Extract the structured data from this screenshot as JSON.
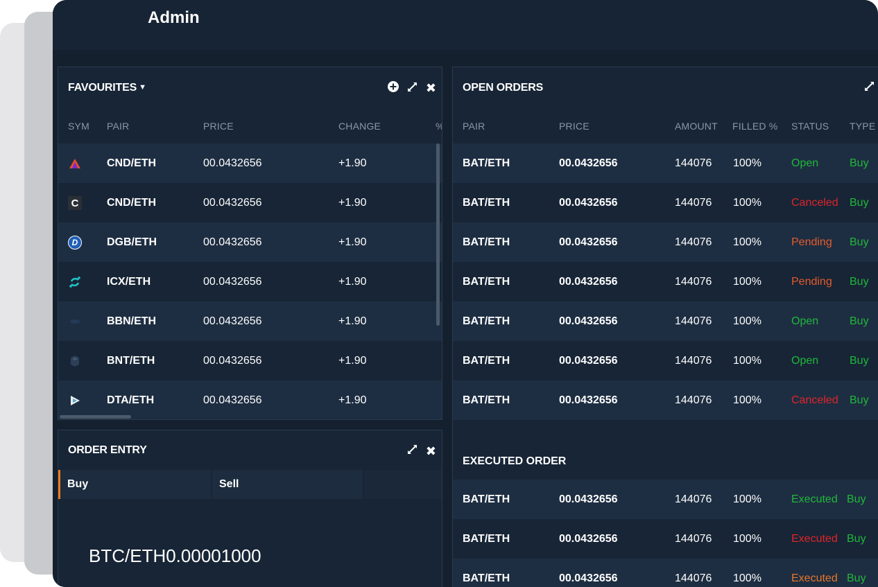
{
  "app": {
    "title": "Admin"
  },
  "favourites": {
    "title": "FAVOURITES",
    "columns": [
      "SYM",
      "PAIR",
      "PRICE",
      "CHANGE",
      "%"
    ],
    "rows": [
      {
        "icon": "triangle-logo-icon",
        "pair": "CND/ETH",
        "price": "00.0432656",
        "change": "+1.90"
      },
      {
        "icon": "c-logo-icon",
        "pair": "CND/ETH",
        "price": "00.0432656",
        "change": "+1.90"
      },
      {
        "icon": "digibyte-logo-icon",
        "pair": "DGB/ETH",
        "price": "00.0432656",
        "change": "+1.90"
      },
      {
        "icon": "icon-logo-icon",
        "pair": "ICX/ETH",
        "price": "00.0432656",
        "change": "+1.90"
      },
      {
        "icon": "bbn-logo-icon",
        "pair": "BBN/ETH",
        "price": "00.0432656",
        "change": "+1.90"
      },
      {
        "icon": "bancor-logo-icon",
        "pair": "BNT/ETH",
        "price": "00.0432656",
        "change": "+1.90"
      },
      {
        "icon": "data-logo-icon",
        "pair": "DTA/ETH",
        "price": "00.0432656",
        "change": "+1.90"
      }
    ]
  },
  "order_entry": {
    "title": "ORDER ENTRY",
    "tabs": [
      "Buy",
      "Sell"
    ],
    "pair_price": "BTC/ETH0.00001000"
  },
  "open_orders": {
    "title": "OPEN ORDERS",
    "columns": [
      "PAIR",
      "PRICE",
      "AMOUNT",
      "FILLED %",
      "STATUS",
      "TYPE"
    ],
    "rows": [
      {
        "pair": "BAT/ETH",
        "price": "00.0432656",
        "amount": "144076",
        "filled": "100%",
        "status": "Open",
        "type": "Buy"
      },
      {
        "pair": "BAT/ETH",
        "price": "00.0432656",
        "amount": "144076",
        "filled": "100%",
        "status": "Canceled",
        "type": "Buy"
      },
      {
        "pair": "BAT/ETH",
        "price": "00.0432656",
        "amount": "144076",
        "filled": "100%",
        "status": "Pending",
        "type": "Buy"
      },
      {
        "pair": "BAT/ETH",
        "price": "00.0432656",
        "amount": "144076",
        "filled": "100%",
        "status": "Pending",
        "type": "Buy"
      },
      {
        "pair": "BAT/ETH",
        "price": "00.0432656",
        "amount": "144076",
        "filled": "100%",
        "status": "Open",
        "type": "Buy"
      },
      {
        "pair": "BAT/ETH",
        "price": "00.0432656",
        "amount": "144076",
        "filled": "100%",
        "status": "Open",
        "type": "Buy"
      },
      {
        "pair": "BAT/ETH",
        "price": "00.0432656",
        "amount": "144076",
        "filled": "100%",
        "status": "Canceled",
        "type": "Buy"
      }
    ]
  },
  "executed_orders": {
    "title": "EXECUTED ORDER",
    "rows": [
      {
        "pair": "BAT/ETH",
        "price": "00.0432656",
        "amount": "144076",
        "filled": "100%",
        "status": "Executed",
        "type": "Buy"
      },
      {
        "pair": "BAT/ETH",
        "price": "00.0432656",
        "amount": "144076",
        "filled": "100%",
        "status": "Executed",
        "type": "Buy"
      },
      {
        "pair": "BAT/ETH",
        "price": "00.0432656",
        "amount": "144076",
        "filled": "100%",
        "status": "Executed",
        "type": "Buy"
      }
    ]
  },
  "colors": {
    "background": "#14202d",
    "panel": "#172536",
    "row_alt": "#1e2e42",
    "green": "#1fb83a",
    "red": "#e0242a",
    "orange": "#e65a2b",
    "active_tab_accent": "#f07a1e"
  }
}
